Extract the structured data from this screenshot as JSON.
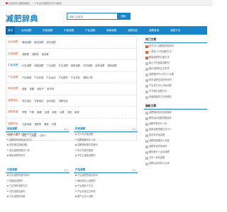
{
  "topbar": {
    "text": "欢迎来到 减肥辞典网，一个专业的减肥知识学习网站!"
  },
  "header": {
    "logo": "减肥辞典"
  },
  "search": {
    "placeholder": "请输入关键词",
    "button": "搜索"
  },
  "nav": {
    "items": [
      "首页",
      "运动减肥",
      "饮食减肥",
      "中医减肥",
      "产后减肥",
      "局部减肥",
      "减肥误区",
      "减肥食谱",
      "减肥方法"
    ]
  },
  "categories": [
    {
      "label": "运动减肥",
      "items": [
        "瑜伽减肥",
        "跑步减肥",
        "游泳减肥"
      ]
    },
    {
      "label": "饮食减肥",
      "items": [
        "减肥餐",
        "减肥茶",
        "健身餐"
      ]
    },
    {
      "label": "中医减肥",
      "items": [
        "针灸减肥",
        "拔罐减肥",
        "穴位减肥",
        "艾灸减肥",
        "按摩减肥",
        "中药减肥",
        "刮痧减肥",
        "埋线减肥"
      ]
    },
    {
      "label": "产后减肥",
      "items": [
        "产后瑜伽",
        "产后饮食",
        "产后运动",
        "产后塑形",
        "产后恢复",
        "减肥心得"
      ]
    },
    {
      "label": "局部减肥",
      "items": [
        "瘦腿",
        "瘦腰",
        "瘦肚子",
        "瘦手臂"
      ]
    },
    {
      "label": "减肥误区",
      "items": [
        "常见误区",
        "饮食误区",
        "运动误区",
        "减肥谣言"
      ]
    },
    {
      "label": "减肥食谱",
      "items": [
        "早餐",
        "午餐",
        "晚餐",
        "加餐",
        "蔬菜",
        "水果",
        "汤类",
        "粥类"
      ]
    },
    {
      "label": "减肥药品",
      "items": [
        "左旋肉碱",
        "减肥茶",
        "酵素",
        "代餐"
      ]
    },
    {
      "label": "减肥人群",
      "items": [
        "学生",
        "上班族",
        "中年人"
      ]
    }
  ],
  "sidebar": {
    "hot_title": "热门文章",
    "hot_items": [
      "夏天怎么减肥最快最有效",
      "一周瘦十斤的减肥方法",
      "瑜伽减肥的正确方法",
      "晚上不吃饭能减肥吗",
      "跑步减肥的注意事项",
      "减肥期间可以吃什么水果",
      "喝水减肥法真的有效吗",
      "产后多久可以开始减肥",
      "不节食的减肥方法",
      "快速瘦腿的方法有哪些"
    ],
    "latest_title": "最新文章",
    "latest_items": [
      "减肥期间如何控制食欲",
      "哪些运动减肥效果最好",
      "减肥早餐吃什么好",
      "健身减肥需要注意什么",
      "如何科学地减肥",
      "減肥瓶颈期怎么突破",
      "减肥茶真的有用吗",
      "睡前做什么运动减肥",
      "中年人如何减肥",
      "减肥后如何防止反弹"
    ]
  },
  "boxes": [
    {
      "title": "运动减肥",
      "more": "更多",
      "items": [
        "为什么很多人跑步减不了肥",
        "减肥最有效的运动方式",
        "怎样通过跳绳减肥",
        "游泳减肥效果怎么样",
        "瑜伽减肥的动作"
      ]
    },
    {
      "title": "饮食减肥",
      "more": "更多",
      "items": [
        "怎么吃才能减肥",
        "减肥晚餐吃什么好",
        "减肥期间能吃零食吗",
        "低卡饮食的搭配",
        "不吃主食能减肥吗"
      ]
    },
    {
      "title": "中医减肥",
      "more": "更多",
      "items": [
        "针灸减肥有副作用吗",
        "拔罐能减肥吗",
        "穴位按摩减肥方法",
        "中药减肥靠谱吗",
        "艾灸减肥的效果"
      ]
    },
    {
      "title": "产后减肥",
      "more": "更多",
      "items": [
        "产后减肥的最佳时间",
        "哺乳期可以减肥吗",
        "产后瘦肚子方法",
        "产后饮食注意事项",
        "顺产后怎么减肥"
      ]
    }
  ]
}
